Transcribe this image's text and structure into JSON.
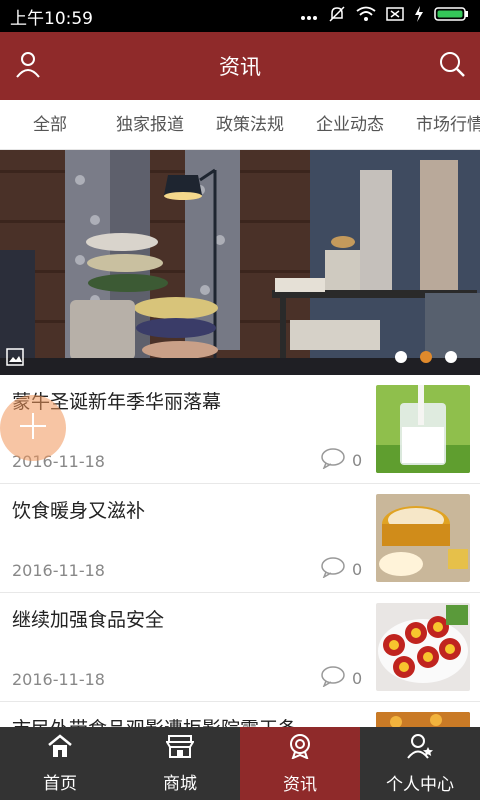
{
  "status": {
    "time": "上午10:59",
    "icons": [
      "dots-icon",
      "mute-icon",
      "wifi-icon",
      "sim-icon",
      "charge-icon",
      "battery-icon"
    ]
  },
  "header": {
    "title": "资讯",
    "left_icon": "user-icon",
    "right_icon": "search-icon"
  },
  "tabs": [
    {
      "label": "全部"
    },
    {
      "label": "独家报道"
    },
    {
      "label": "政策法规"
    },
    {
      "label": "企业动态"
    },
    {
      "label": "市场行情"
    }
  ],
  "hero": {
    "carousel": {
      "count": 3,
      "active_index": 1
    }
  },
  "articles": [
    {
      "title": "蒙牛圣诞新年季华丽落幕",
      "date": "2016-11-18",
      "comments": "0",
      "thumb": "milk-glass"
    },
    {
      "title": "饮食暖身又滋补",
      "date": "2016-11-18",
      "comments": "0",
      "thumb": "hotpot"
    },
    {
      "title": "继续加强食品安全",
      "date": "2016-11-18",
      "comments": "0",
      "thumb": "eggs"
    },
    {
      "title": "市民外带食品观影遭拒影院霸王条",
      "date": "",
      "comments": "",
      "thumb": "food"
    }
  ],
  "bottom_nav": [
    {
      "label": "首页",
      "icon": "home-icon",
      "active": false
    },
    {
      "label": "商城",
      "icon": "store-icon",
      "active": false
    },
    {
      "label": "资讯",
      "icon": "badge-icon",
      "active": true
    },
    {
      "label": "个人中心",
      "icon": "person-star-icon",
      "active": false
    }
  ],
  "colors": {
    "brand": "#8f2a2a",
    "nav_bg": "#333333",
    "active_dot": "#e08a2c"
  }
}
